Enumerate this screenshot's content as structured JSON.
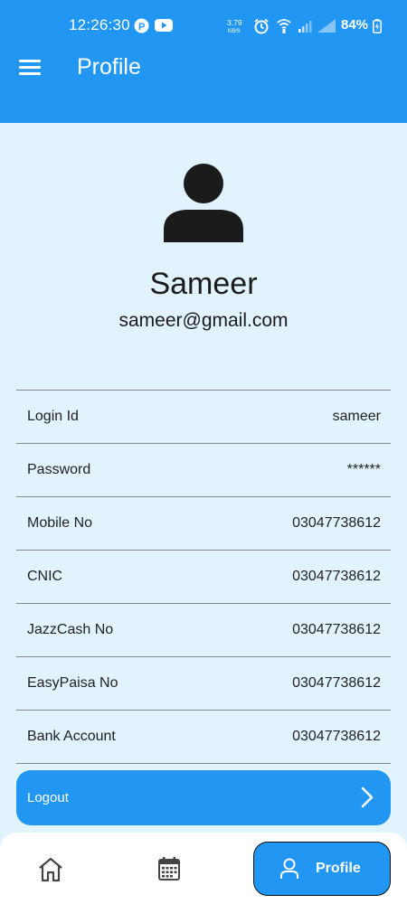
{
  "status_bar": {
    "time": "12:26:30",
    "net_speed": "3.79",
    "net_unit": "KB/S",
    "battery": "84%"
  },
  "app_bar": {
    "title": "Profile",
    "menu_icon": "menu-icon"
  },
  "profile": {
    "avatar_icon": "person-icon",
    "name": "Sameer",
    "email": "sameer@gmail.com"
  },
  "details": [
    {
      "label": "Login Id",
      "value": "sameer"
    },
    {
      "label": "Password",
      "value": "******"
    },
    {
      "label": "Mobile No",
      "value": "03047738612"
    },
    {
      "label": "CNIC",
      "value": "03047738612"
    },
    {
      "label": "JazzCash No",
      "value": "03047738612"
    },
    {
      "label": "EasyPaisa No",
      "value": "03047738612"
    },
    {
      "label": "Bank Account",
      "value": "03047738612"
    }
  ],
  "logout": {
    "label": "Logout",
    "icon": "chevron-right-icon"
  },
  "bottom_nav": {
    "home_icon": "home-icon",
    "calendar_icon": "calendar-icon",
    "profile_label": "Profile",
    "profile_icon": "person-icon"
  },
  "colors": {
    "primary": "#2196f3",
    "background": "#e1f3fd"
  }
}
